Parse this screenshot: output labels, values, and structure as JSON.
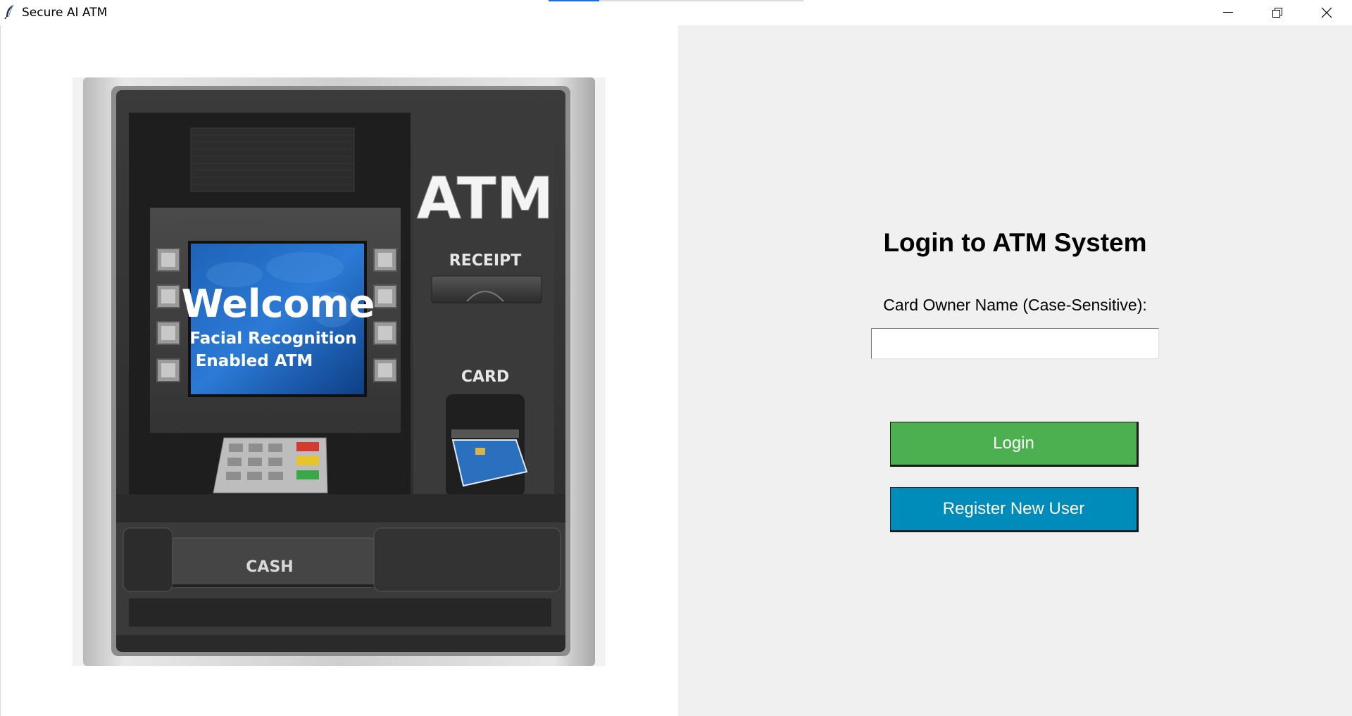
{
  "window": {
    "title": "Secure AI ATM",
    "icon": "feather-icon",
    "controls": [
      "minimize-icon",
      "restore-icon",
      "close-icon"
    ]
  },
  "atm_image": {
    "brand": "ATM",
    "receipt_label": "RECEIPT",
    "card_label": "CARD",
    "cash_label": "CASH",
    "screen_title": "Welcome",
    "screen_line1": "Facial Recognition",
    "screen_line2": "Enabled ATM"
  },
  "login": {
    "title": "Login to ATM System",
    "field_label": "Card Owner Name (Case-Sensitive):",
    "field_value": "",
    "login_label": "Login",
    "register_label": "Register New User"
  },
  "colors": {
    "login_button": "#4caf50",
    "register_button": "#008cba",
    "panel_bg": "#f0f0f0"
  }
}
